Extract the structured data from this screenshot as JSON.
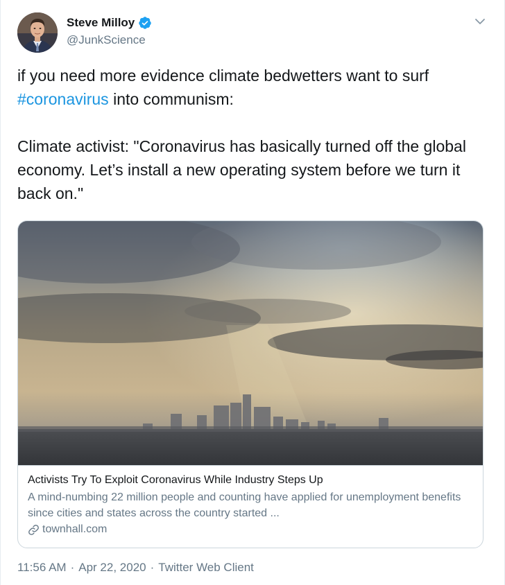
{
  "author": {
    "display_name": "Steve Milloy",
    "handle": "@JunkScience",
    "verified": true,
    "avatar_icon": "user-photo"
  },
  "tweet": {
    "text_part1": "if you need more evidence climate bedwetters want to surf ",
    "hashtag": "#coronavirus",
    "text_part2": " into communism:\n\nClimate activist: \"Coronavirus has basically turned off the global economy. Let’s install a new operating system before we turn it back on.\""
  },
  "card": {
    "image_description_icon": "city-skyline-smog-image",
    "title": "Activists Try To Exploit Coronavirus While Industry Steps Up",
    "description": "A mind-numbing 22 million people and counting have applied for unemployment benefits since cities and states across the country started ...",
    "domain": "townhall.com"
  },
  "meta": {
    "time": "11:56 AM",
    "date": "Apr 22, 2020",
    "separator": "·",
    "source": "Twitter Web Client"
  },
  "colors": {
    "link_blue": "#1b95e0",
    "verified_blue": "#1da1f2",
    "secondary_text": "#657786",
    "border": "#ccd6dd"
  }
}
